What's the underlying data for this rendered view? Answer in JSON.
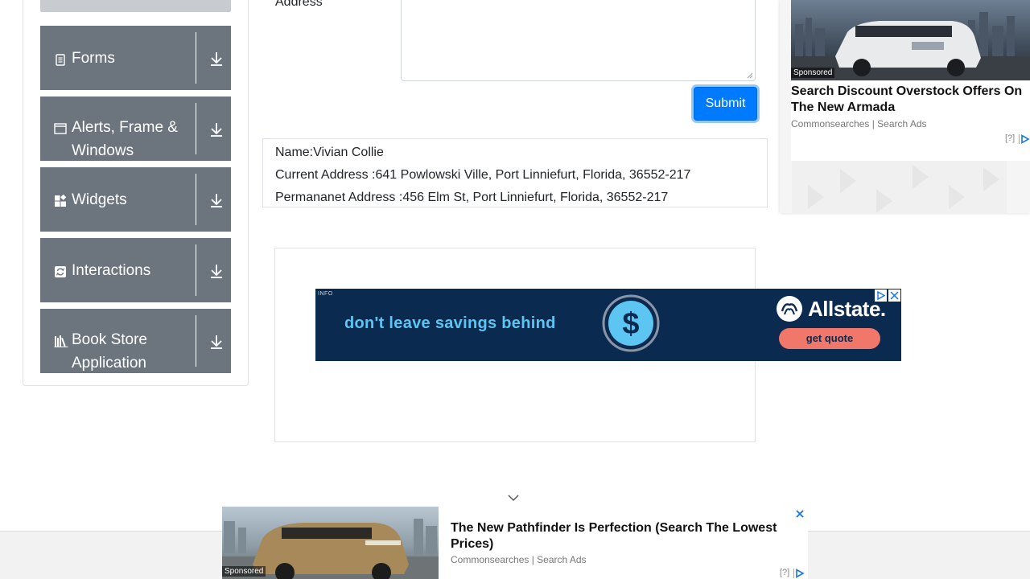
{
  "sidebar": {
    "groups": [
      {
        "label": "Forms",
        "icon": "form-icon"
      },
      {
        "label": "Alerts, Frame & Windows",
        "icon": "window-icon"
      },
      {
        "label": "Widgets",
        "icon": "widgets-icon"
      },
      {
        "label": "Interactions",
        "icon": "interactions-icon"
      },
      {
        "label": "Book Store Application",
        "icon": "books-icon"
      }
    ]
  },
  "form": {
    "address_label": "Address",
    "submit_label": "Submit",
    "accent": "#007bff"
  },
  "output": {
    "name": "Name:Vivian Collie",
    "current_address": "Current Address :641 Powlowski Ville, Port Linniefurt, Florida, 36552-217",
    "permanent_address": "Permananet Address :456 Elm St, Port Linniefurt, Florida, 36552-217"
  },
  "ads": {
    "allstate": {
      "tag": "INFO",
      "headline": "don't leave savings behind",
      "brand": "Allstate.",
      "cta": "get quote"
    },
    "right": {
      "sponsored": "Sponsored",
      "title": "Search Discount Overstock Offers On The New Armada",
      "source": "Commonsearches | Search Ads",
      "qmark": "[?]"
    },
    "bottom": {
      "sponsored": "Sponsored",
      "title": "The New Pathfinder Is Perfection (Search The Lowest Prices)",
      "source": "Commonsearches | Search Ads",
      "qmark": "[?]"
    }
  }
}
